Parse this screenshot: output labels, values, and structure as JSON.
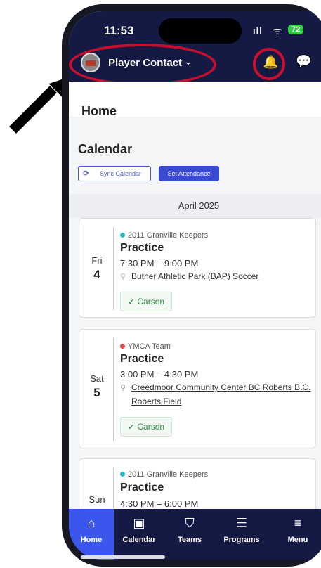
{
  "status_bar": {
    "time": "11:53",
    "signal": "ıll",
    "wifi": "ᯤ",
    "battery": "72"
  },
  "header": {
    "context_title": "Player Contact",
    "chevron": "⌄",
    "bell_icon": "🔔",
    "chat_icon": "💬"
  },
  "page": {
    "title": "Home"
  },
  "calendar": {
    "title": "Calendar",
    "sync_label": "Sync Calendar",
    "attendance_label": "Set Attendance",
    "month": "April 2025",
    "events": [
      {
        "dow": "Fri",
        "day": "4",
        "team": "2011 Granville Keepers",
        "team_color": "#2ab7c6",
        "title": "Practice",
        "time": "7:30 PM – 9:00 PM",
        "location": "Butner Athletic Park (BAP) Soccer",
        "attendee": "Carson"
      },
      {
        "dow": "Sat",
        "day": "5",
        "team": "YMCA Team",
        "team_color": "#e84a4a",
        "title": "Practice",
        "time": "3:00 PM – 4:30 PM",
        "location": "Creedmoor Community Center BC Roberts B.C. Roberts Field",
        "attendee": "Carson"
      },
      {
        "dow": "Sun",
        "day": "",
        "team": "2011 Granville Keepers",
        "team_color": "#2ab7c6",
        "title": "Practice",
        "time": "4:30 PM – 6:00 PM",
        "location": "",
        "attendee": ""
      }
    ]
  },
  "tabs": [
    {
      "label": "Home",
      "icon": "⌂"
    },
    {
      "label": "Calendar",
      "icon": "▣"
    },
    {
      "label": "Teams",
      "icon": "⛉"
    },
    {
      "label": "Programs",
      "icon": "☰"
    },
    {
      "label": "Menu",
      "icon": "≡"
    }
  ],
  "colors": {
    "navy": "#151a45",
    "accent": "#3b56ec",
    "annotation_red": "#c8102e"
  }
}
